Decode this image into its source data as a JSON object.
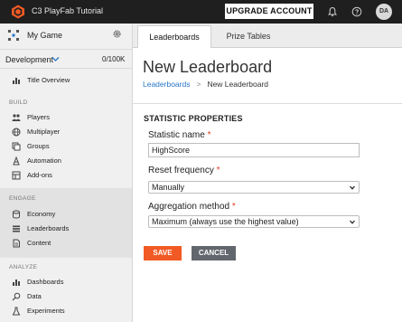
{
  "topbar": {
    "app_title": "C3 PlayFab Tutorial",
    "upgrade_label": "UPGRADE ACCOUNT",
    "avatar_initials": "DA",
    "icons": [
      "playfab-logo-icon",
      "bell-icon",
      "help-icon"
    ]
  },
  "sidebar": {
    "game_name": "My Game",
    "environment": "Development",
    "usage": "0/100K",
    "title_overview": "Title Overview",
    "sections": {
      "build": "BUILD",
      "engage": "ENGAGE",
      "analyze": "ANALYZE"
    },
    "build_items": [
      "Players",
      "Multiplayer",
      "Groups",
      "Automation",
      "Add-ons"
    ],
    "engage_items": [
      "Economy",
      "Leaderboards",
      "Content"
    ],
    "analyze_items": [
      "Dashboards",
      "Data",
      "Experiments"
    ]
  },
  "tabs": [
    "Leaderboards",
    "Prize Tables"
  ],
  "page": {
    "title": "New Leaderboard",
    "breadcrumb_link": "Leaderboards",
    "breadcrumb_separator": ">",
    "breadcrumb_current": "New Leaderboard"
  },
  "form": {
    "section_title": "STATISTIC PROPERTIES",
    "statistic_name_label": "Statistic name",
    "statistic_name_value": "HighScore",
    "reset_frequency_label": "Reset frequency",
    "reset_frequency_value": "Manually",
    "aggregation_label": "Aggregation method",
    "aggregation_value": "Maximum (always use the highest value)",
    "required_mark": "*",
    "save_label": "SAVE",
    "cancel_label": "CANCEL"
  },
  "colors": {
    "accent": "#f15a24",
    "link": "#2a77c9",
    "required": "#e03b1f",
    "topbar": "#1f1f1f"
  }
}
